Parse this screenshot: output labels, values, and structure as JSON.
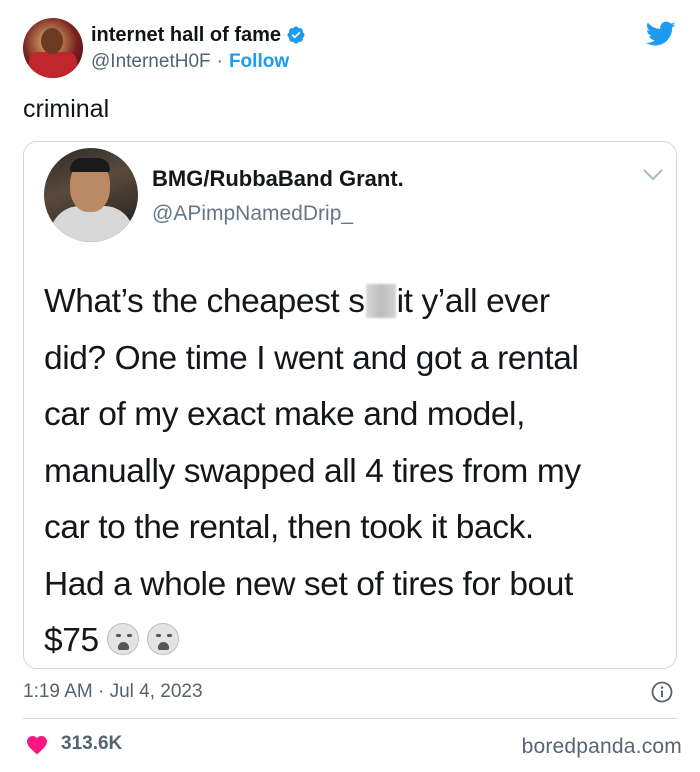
{
  "tweet": {
    "author": {
      "display_name": "internet hall of fame",
      "handle": "@InternetH0F",
      "separator": "·",
      "follow_label": "Follow",
      "verified_icon": "verified-badge-icon"
    },
    "text": "criminal",
    "timestamp": "1:19 AM · Jul 4, 2023",
    "like_count": "313.6K",
    "brand_color": "#1d9bf0",
    "like_color": "#f91880"
  },
  "quoted_tweet": {
    "display_name": "BMG/RubbaBand Grant.",
    "handle": "@APimpNamedDrip_",
    "body_lines": [
      {
        "before": "What’s the cheapest s",
        "after": "it y’all ever"
      },
      "did? One time I went and got a rental",
      "car of my exact make and model,",
      "manually swapped all 4 tires from my",
      "car to the rental, then took it back.",
      "Had a whole new set of tires for bout",
      "$75"
    ],
    "emoji": [
      "loudly-crying-face-emoji",
      "loudly-crying-face-emoji"
    ]
  },
  "watermark": "boredpanda.com"
}
